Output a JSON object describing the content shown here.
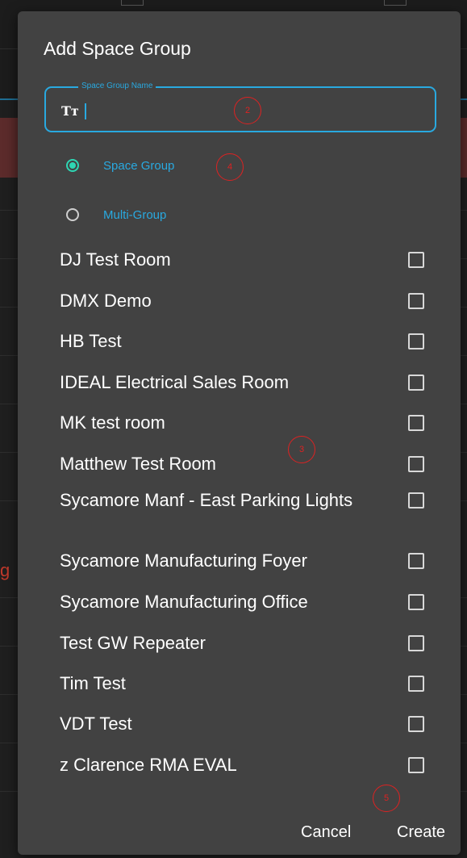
{
  "dialog": {
    "title": "Add Space Group",
    "name_field": {
      "legend": "Space Group Name",
      "icon": "text-format-icon",
      "icon_glyph": "Tт",
      "value": ""
    },
    "group_types": [
      {
        "label": "Space Group",
        "selected": true
      },
      {
        "label": "Multi-Group",
        "selected": false
      }
    ],
    "spaces": [
      {
        "label": "DJ Test Room",
        "checked": false
      },
      {
        "label": "DMX Demo",
        "checked": false
      },
      {
        "label": "HB Test",
        "checked": false
      },
      {
        "label": "IDEAL Electrical Sales Room",
        "checked": false
      },
      {
        "label": "MK test room",
        "checked": false
      },
      {
        "label": "Matthew Test Room",
        "checked": false
      },
      {
        "label": "Sycamore Manf - East Parking Lights",
        "checked": false
      },
      {
        "label": "Sycamore Manufacturing Foyer",
        "checked": false
      },
      {
        "label": "Sycamore Manufacturing Office",
        "checked": false
      },
      {
        "label": "Test GW Repeater",
        "checked": false
      },
      {
        "label": "Tim Test",
        "checked": false
      },
      {
        "label": "VDT Test",
        "checked": false
      },
      {
        "label": "z Clarence RMA EVAL",
        "checked": false
      }
    ],
    "actions": {
      "cancel": "Cancel",
      "create": "Create"
    }
  },
  "annotations": [
    "2",
    "4",
    "3",
    "5"
  ],
  "background": {
    "edge_letter": "g"
  },
  "colors": {
    "dialog_bg": "#424242",
    "accent_blue": "#29a9e0",
    "radio_selected": "#2ed6b3",
    "annotation_red": "#dd2222"
  }
}
